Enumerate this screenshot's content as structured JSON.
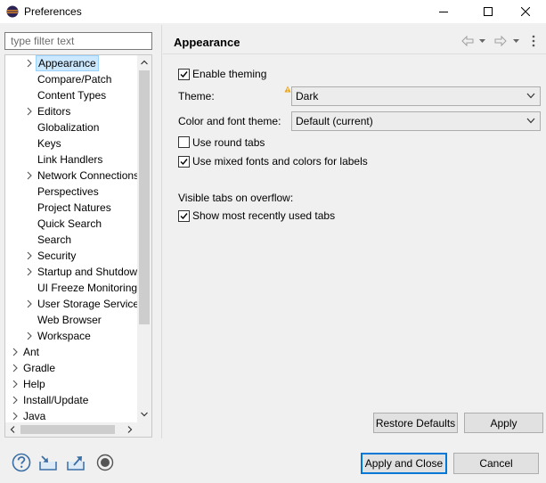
{
  "window": {
    "title": "Preferences"
  },
  "filter": {
    "placeholder": "type filter text"
  },
  "tree": {
    "items": [
      {
        "label": "Appearance",
        "expandable": true,
        "selected": true
      },
      {
        "label": "Compare/Patch",
        "expandable": false
      },
      {
        "label": "Content Types",
        "expandable": false
      },
      {
        "label": "Editors",
        "expandable": true
      },
      {
        "label": "Globalization",
        "expandable": false
      },
      {
        "label": "Keys",
        "expandable": false
      },
      {
        "label": "Link Handlers",
        "expandable": false
      },
      {
        "label": "Network Connections",
        "expandable": true
      },
      {
        "label": "Perspectives",
        "expandable": false
      },
      {
        "label": "Project Natures",
        "expandable": false
      },
      {
        "label": "Quick Search",
        "expandable": false
      },
      {
        "label": "Search",
        "expandable": false
      },
      {
        "label": "Security",
        "expandable": true
      },
      {
        "label": "Startup and Shutdown",
        "expandable": true
      },
      {
        "label": "UI Freeze Monitoring",
        "expandable": false
      },
      {
        "label": "User Storage Service",
        "expandable": true
      },
      {
        "label": "Web Browser",
        "expandable": false
      },
      {
        "label": "Workspace",
        "expandable": true
      },
      {
        "label": "Ant",
        "expandable": true,
        "top": true
      },
      {
        "label": "Gradle",
        "expandable": true,
        "top": true
      },
      {
        "label": "Help",
        "expandable": true,
        "top": true
      },
      {
        "label": "Install/Update",
        "expandable": true,
        "top": true
      },
      {
        "label": "Java",
        "expandable": true,
        "top": true
      }
    ]
  },
  "page": {
    "title": "Appearance",
    "enable_theming": {
      "label": "Enable theming",
      "checked": true
    },
    "theme": {
      "label": "Theme:",
      "value": "Dark"
    },
    "color_font_theme": {
      "label": "Color and font theme:",
      "value": "Default (current)"
    },
    "round_tabs": {
      "label": "Use round tabs",
      "checked": false
    },
    "mixed_fonts": {
      "label": "Use mixed fonts and colors for labels",
      "checked": true
    },
    "visible_tabs_heading": "Visible tabs on overflow:",
    "recent_tabs": {
      "label": "Show most recently used tabs",
      "checked": true
    },
    "restore_defaults": "Restore Defaults",
    "apply": "Apply"
  },
  "footer": {
    "apply_close": "Apply and Close",
    "cancel": "Cancel"
  },
  "colors": {
    "selection": "#cce8ff",
    "default_button_border": "#0078d7",
    "warning_icon": "#e8a317"
  }
}
